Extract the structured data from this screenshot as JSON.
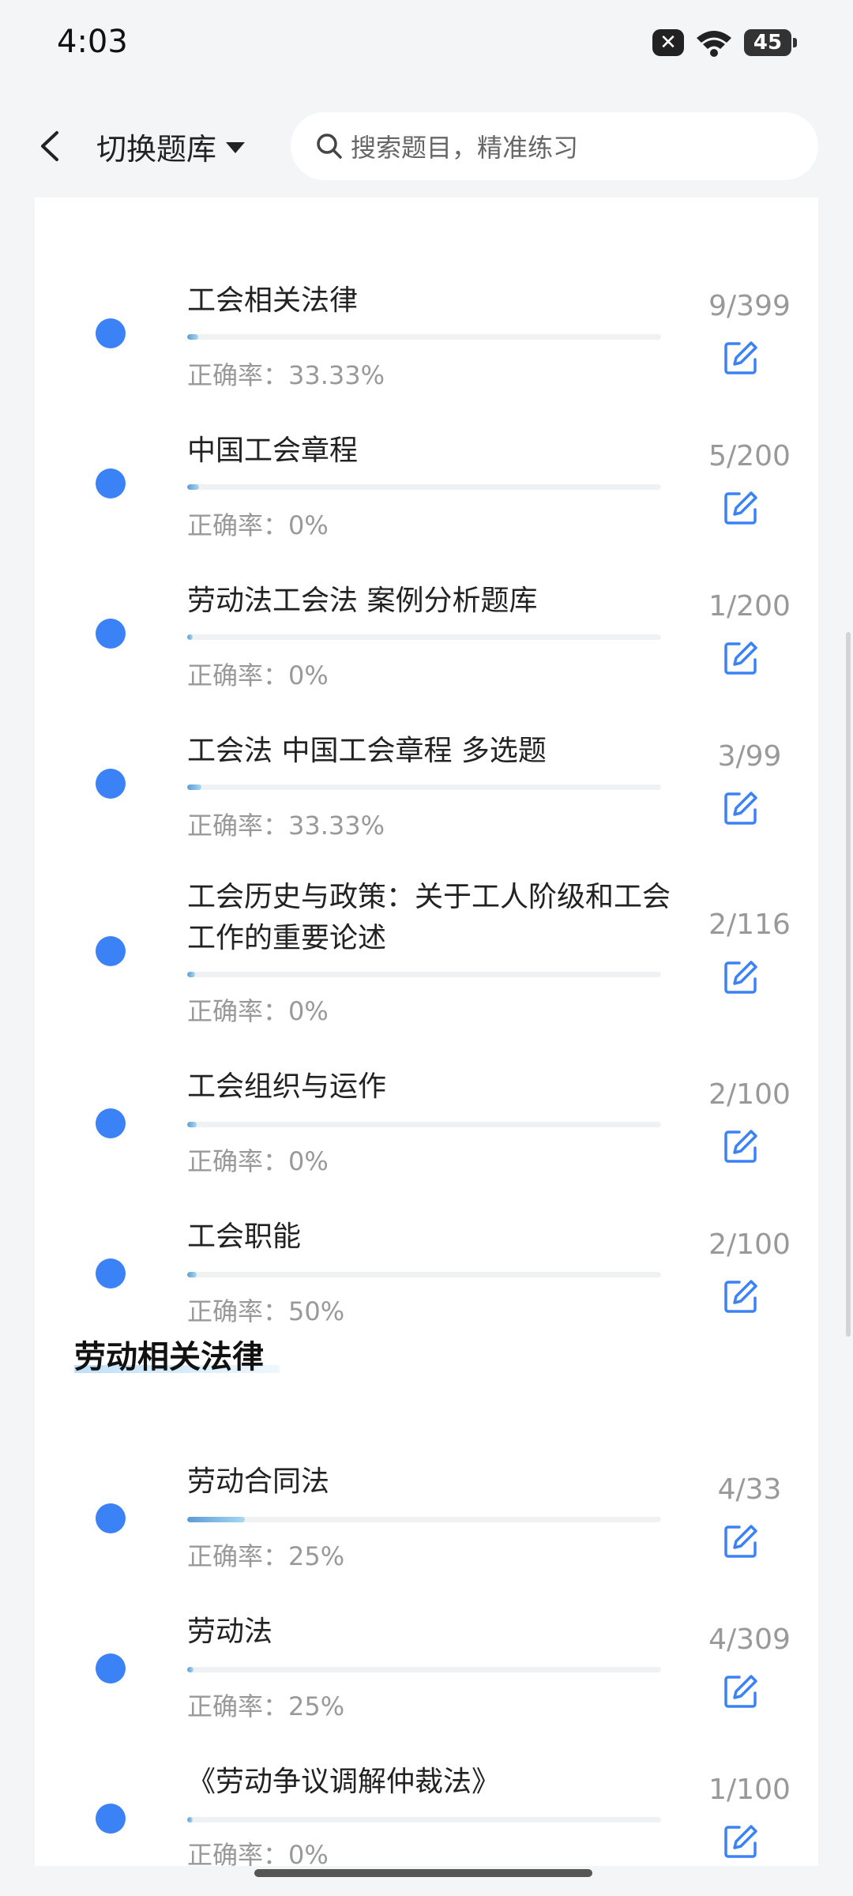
{
  "status": {
    "time": "4:03",
    "battery": "45"
  },
  "nav": {
    "library_label": "切换题库",
    "search_placeholder": "搜索题目，精准练习"
  },
  "accuracy_prefix": "正确率：",
  "groups": [
    {
      "items": [
        {
          "title": "工会相关法律",
          "accuracy": "33.33%",
          "count": "9/399",
          "progress": 0.023
        },
        {
          "title": "中国工会章程",
          "accuracy": "0%",
          "count": "5/200",
          "progress": 0.025
        },
        {
          "title": "劳动法工会法 案例分析题库",
          "accuracy": "0%",
          "count": "1/200",
          "progress": 0.005
        },
        {
          "title": "工会法 中国工会章程 多选题",
          "accuracy": "33.33%",
          "count": "3/99",
          "progress": 0.03
        },
        {
          "title": "工会历史与政策：关于工人阶级和工会工作的重要论述",
          "accuracy": "0%",
          "count": "2/116",
          "progress": 0.017
        },
        {
          "title": "工会组织与运作",
          "accuracy": "0%",
          "count": "2/100",
          "progress": 0.02
        },
        {
          "title": "工会职能",
          "accuracy": "50%",
          "count": "2/100",
          "progress": 0.02
        }
      ]
    },
    {
      "section_title": "劳动相关法律",
      "items": [
        {
          "title": "劳动合同法",
          "accuracy": "25%",
          "count": "4/33",
          "progress": 0.121
        },
        {
          "title": "劳动法",
          "accuracy": "25%",
          "count": "4/309",
          "progress": 0.013
        },
        {
          "title": "《劳动争议调解仲裁法》",
          "accuracy": "0%",
          "count": "1/100",
          "progress": 0.01
        }
      ]
    }
  ],
  "colors": {
    "accent": "#3b82f6",
    "muted": "#999999"
  },
  "icons": [
    "back-icon",
    "caret-down-icon",
    "search-icon",
    "edit-icon",
    "wifi-icon",
    "battery-icon",
    "notification-close-icon"
  ]
}
